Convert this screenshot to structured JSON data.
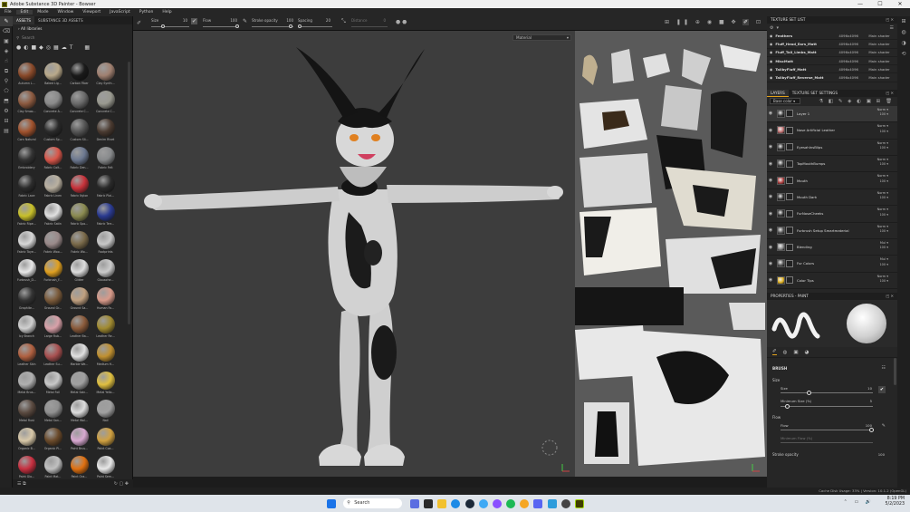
{
  "window": {
    "title": "Adobe Substance 3D Painter - Bowser"
  },
  "menu": [
    "File",
    "Edit",
    "Mode",
    "Window",
    "Viewport",
    "JavaScript",
    "Python",
    "Help"
  ],
  "menu_active_index": 1,
  "assets": {
    "tabs": [
      "ASSETS",
      "SUBSTANCE 3D ASSETS"
    ],
    "breadcrumb": "All libraries",
    "search_placeholder": "Search",
    "items": [
      {
        "label": "Autumn L...",
        "color": "#8a4a2a"
      },
      {
        "label": "Baked Lig...",
        "color": "#b9a98a"
      },
      {
        "label": "Carbon Fiber",
        "color": "#1a1a1a"
      },
      {
        "label": "Clay Synth...",
        "color": "#a08070"
      },
      {
        "label": "Clay Smoo...",
        "color": "#8c5a40"
      },
      {
        "label": "Concrete A...",
        "color": "#8a8a8a"
      },
      {
        "label": "Concrete C...",
        "color": "#6a6a6a"
      },
      {
        "label": "Concrete C...",
        "color": "#9a9a90"
      },
      {
        "label": "Corn Natural",
        "color": "#a0522d"
      },
      {
        "label": "Custom Sp...",
        "color": "#2a2a2a"
      },
      {
        "label": "Custom Sli...",
        "color": "#555555"
      },
      {
        "label": "Denim Rivet",
        "color": "#4a3a30"
      },
      {
        "label": "Embroidery",
        "color": "#333333"
      },
      {
        "label": "Fabric Colt...",
        "color": "#d9564a"
      },
      {
        "label": "Fabric Den...",
        "color": "#6c7890"
      },
      {
        "label": "Fabric Felt",
        "color": "#888a8c"
      },
      {
        "label": "Fabric Lace",
        "color": "#2c2c2c"
      },
      {
        "label": "Fabric Linen",
        "color": "#b9b0a0"
      },
      {
        "label": "Fabric Nylon",
        "color": "#c8323a"
      },
      {
        "label": "Fabric Plai...",
        "color": "#2a2a2a"
      },
      {
        "label": "Fabric Ripe...",
        "color": "#c8c02a"
      },
      {
        "label": "Fabric Satin",
        "color": "#e0e0e0"
      },
      {
        "label": "Fabric Spo...",
        "color": "#8a8a50"
      },
      {
        "label": "Fabric Terr...",
        "color": "#2a3a90"
      },
      {
        "label": "Fabric Toye...",
        "color": "#d8d8d8"
      },
      {
        "label": "Fabric Woo...",
        "color": "#9a8a8a"
      },
      {
        "label": "Fabric Wo...",
        "color": "#7a6a4a"
      },
      {
        "label": "Footprints",
        "color": "#c8c8c8"
      },
      {
        "label": "Furbrush_D...",
        "color": "#e8e8e8"
      },
      {
        "label": "Furbrush_F...",
        "color": "#e0a020"
      },
      {
        "label": "Glitter",
        "color": "#dddddd"
      },
      {
        "label": "Glouache...",
        "color": "#cccccc"
      },
      {
        "label": "Graphite...",
        "color": "#333333"
      },
      {
        "label": "Ground Gr...",
        "color": "#7a5a3a"
      },
      {
        "label": "Ground Sa...",
        "color": "#c0a080"
      },
      {
        "label": "Human Fa...",
        "color": "#d89a8a"
      },
      {
        "label": "Icy Branch",
        "color": "#d0d0d0"
      },
      {
        "label": "Large Rub...",
        "color": "#d8a0a8"
      },
      {
        "label": "Leather Ba...",
        "color": "#8a5a3a"
      },
      {
        "label": "Leather Re...",
        "color": "#a08a30"
      },
      {
        "label": "Leather Skin",
        "color": "#b06040"
      },
      {
        "label": "Leather Su...",
        "color": "#a85050"
      },
      {
        "label": "Marble We...",
        "color": "#e0e0e0"
      },
      {
        "label": "Medium H...",
        "color": "#c09030"
      },
      {
        "label": "Metal Brus...",
        "color": "#b0b0b0"
      },
      {
        "label": "Metal Foil",
        "color": "#c8c8c8"
      },
      {
        "label": "Metal Sain...",
        "color": "#a0a0a0"
      },
      {
        "label": "Metal Yello...",
        "color": "#e0c040"
      },
      {
        "label": "Metal Rust",
        "color": "#5a4a40"
      },
      {
        "label": "Metal San...",
        "color": "#909090"
      },
      {
        "label": "Metal Wal...",
        "color": "#dddddd"
      },
      {
        "label": "Nail",
        "color": "#a0a0a0"
      },
      {
        "label": "Organic B...",
        "color": "#d8c8a8"
      },
      {
        "label": "Organic Pl...",
        "color": "#6a4a2a"
      },
      {
        "label": "Paint Brus...",
        "color": "#d8a8d0"
      },
      {
        "label": "Paint Coa...",
        "color": "#d0a040"
      },
      {
        "label": "Paint Glo...",
        "color": "#c83040"
      },
      {
        "label": "Paint Mat...",
        "color": "#c0c0c0"
      },
      {
        "label": "Paint Ora...",
        "color": "#e07010"
      },
      {
        "label": "Paint Sem...",
        "color": "#e8e8e8"
      }
    ]
  },
  "toolbar": {
    "size_label": "Size",
    "size_value": "10",
    "flow_label": "Flow",
    "flow_value": "100",
    "stroke_label": "Stroke opacity",
    "stroke_value": "100",
    "spacing_label": "Spacing",
    "spacing_value": "20",
    "distance_label": "Distance",
    "distance_value": "0"
  },
  "viewport3d": {
    "mode": "Material"
  },
  "viewport2d": {
    "mode": "Material"
  },
  "texture_set_list": {
    "title": "TEXTURE SET LIST",
    "rows": [
      {
        "name": "Feathers",
        "res": "4096x4096",
        "shader": "Main shader"
      },
      {
        "name": "Fluff_Head_Ears_Matt",
        "res": "4096x4096",
        "shader": "Main shader"
      },
      {
        "name": "Fluff_Tail_Limbs_Matt",
        "res": "4096x4096",
        "shader": "Main shader"
      },
      {
        "name": "MiscMatt",
        "res": "4096x4096",
        "shader": "Main shader"
      },
      {
        "name": "TailbyFluff_Matt",
        "res": "4096x4096",
        "shader": "Main shader"
      },
      {
        "name": "TailbyFluff_Reverse_Matt",
        "res": "4096x4096",
        "shader": "Main shader"
      }
    ]
  },
  "layers": {
    "tabs": [
      "LAYERS",
      "TEXTURE SET SETTINGS"
    ],
    "channel": "Base color",
    "rows": [
      {
        "name": "Layer 1",
        "blend": "Norm",
        "op": "100",
        "thumb": "#3a3a3a",
        "sel": true
      },
      {
        "name": "Nose Artificial Leather",
        "blend": "Norm",
        "op": "100",
        "thumb": "#c07070",
        "sel": false
      },
      {
        "name": "EyesahInsBlips",
        "blend": "Norm",
        "op": "100",
        "thumb": "#333",
        "sel": false
      },
      {
        "name": "TopMouthBumps",
        "blend": "Norm",
        "op": "100",
        "thumb": "#444",
        "sel": false
      },
      {
        "name": "Mouth",
        "blend": "Norm",
        "op": "100",
        "thumb": "#b04040",
        "sel": false
      },
      {
        "name": "Mouth Dark",
        "blend": "Norm",
        "op": "100",
        "thumb": "#333",
        "sel": false
      },
      {
        "name": "FurNoseCheeks",
        "blend": "Norm",
        "op": "100",
        "thumb": "#333",
        "sel": false
      },
      {
        "name": "Furbrush Setup Smartmaterial",
        "blend": "Norm",
        "op": "100",
        "thumb": "#555",
        "sel": false
      },
      {
        "name": "Blending",
        "blend": "Mul",
        "op": "100",
        "thumb": "#888",
        "sel": false
      },
      {
        "name": "Fur Colors",
        "blend": "Mul",
        "op": "100",
        "thumb": "#555",
        "sel": false
      },
      {
        "name": "Color Tips",
        "blend": "Norm",
        "op": "100",
        "thumb": "#e0b020",
        "sel": false
      }
    ]
  },
  "properties": {
    "title": "PROPERTIES - PAINT",
    "brush_section": "BRUSH",
    "size_label": "Size",
    "size_sub": "Size",
    "size_value": "10",
    "min_size_label": "Minimum Size (%)",
    "min_size_value": "5",
    "flow_label": "Flow",
    "flow_sub": "Flow",
    "flow_value": "100",
    "min_flow_label": "Minimum Flow (%)",
    "stroke_label": "Stroke opacity",
    "stroke_value": "100"
  },
  "status": {
    "text": "Cache Disk Usage: 33% | Version: 10.1.2 (OpenGL)"
  },
  "taskbar": {
    "search": "Search",
    "time": "8:19 PM",
    "date": "5/2/2023"
  }
}
